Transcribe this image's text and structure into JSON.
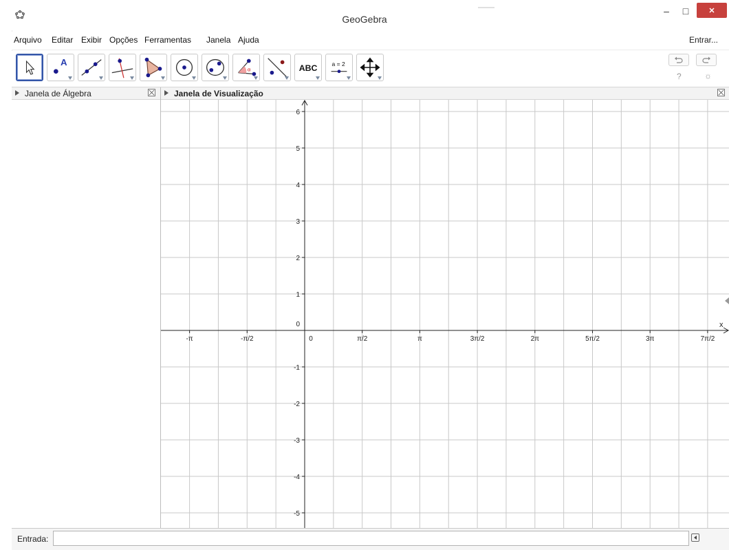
{
  "window": {
    "title": "GeoGebra",
    "minimize_glyph": "–",
    "maximize_glyph": "□",
    "close_glyph": "✕",
    "close_color": "#c7413d"
  },
  "menu": {
    "items": [
      "Arquivo",
      "Editar",
      "Exibir",
      "Opções",
      "Ferramentas",
      "Janela",
      "Ajuda"
    ],
    "login_label": "Entrar..."
  },
  "toolbar": {
    "tools": [
      {
        "name": "move-tool",
        "icon": "arrow-icon"
      },
      {
        "name": "point-tool",
        "icon": "point-icon",
        "label": "A"
      },
      {
        "name": "line-tool",
        "icon": "line-icon"
      },
      {
        "name": "perpendicular-tool",
        "icon": "perpendicular-icon"
      },
      {
        "name": "polygon-tool",
        "icon": "polygon-icon"
      },
      {
        "name": "circle-tool",
        "icon": "circle-icon"
      },
      {
        "name": "ellipse-tool",
        "icon": "ellipse-icon"
      },
      {
        "name": "angle-tool",
        "icon": "angle-icon",
        "label": "α"
      },
      {
        "name": "reflect-tool",
        "icon": "reflect-icon"
      },
      {
        "name": "text-tool",
        "icon": "text-icon",
        "label": "ABC"
      },
      {
        "name": "slider-tool",
        "icon": "slider-icon",
        "label": "a = 2"
      },
      {
        "name": "move-view-tool",
        "icon": "move-view-icon"
      }
    ],
    "undo_icon": "undo-icon",
    "redo_icon": "redo-icon",
    "help_glyph": "?",
    "settings_glyph": "☼"
  },
  "algebra_panel": {
    "title": "Janela de Álgebra"
  },
  "graphics_panel": {
    "title": "Janela de Visualização",
    "x_axis_label": "x",
    "x_ticks": [
      "-π",
      "-π/2",
      "0",
      "π/2",
      "π",
      "3π/2",
      "2π",
      "5π/2",
      "3π",
      "7π/2"
    ],
    "y_ticks": [
      "6",
      "5",
      "4",
      "3",
      "2",
      "1",
      "0",
      "-1",
      "-2",
      "-3",
      "-4",
      "-5"
    ],
    "grid": true
  },
  "input_bar": {
    "label": "Entrada:",
    "value": ""
  }
}
